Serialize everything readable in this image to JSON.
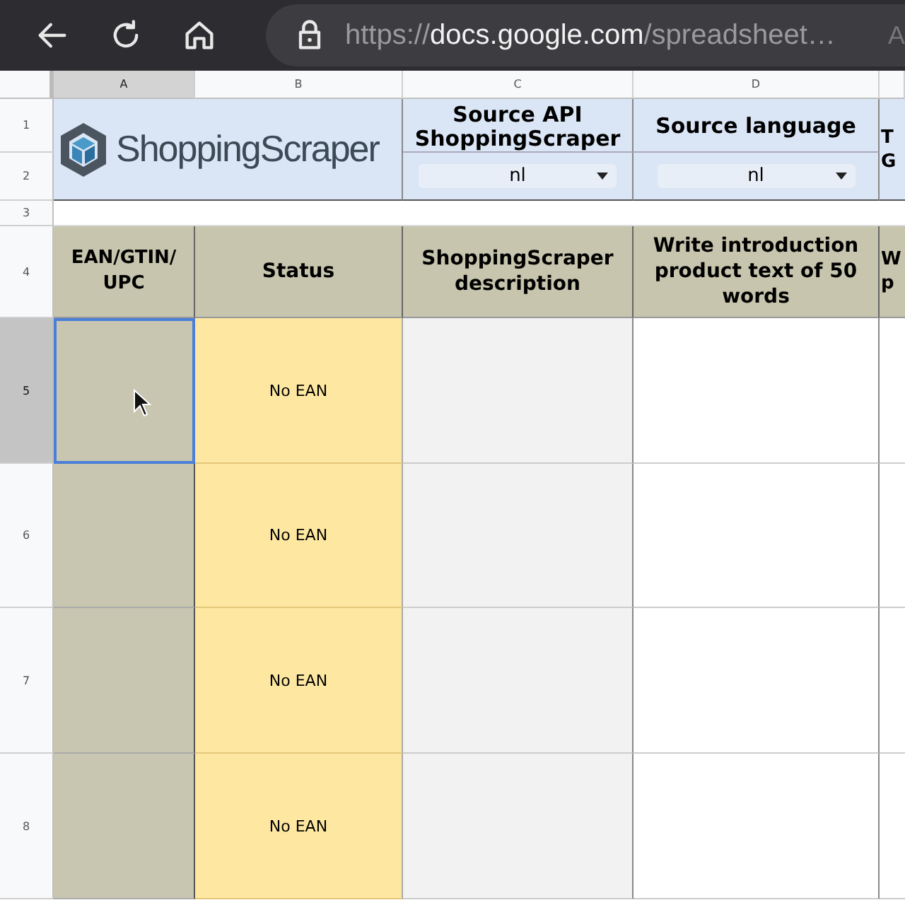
{
  "browser": {
    "url_scheme": "https://",
    "url_host": "docs.google.com",
    "url_path": "/spreadsheet…",
    "edge_text": "A"
  },
  "column_headers": [
    {
      "label": "A",
      "selected": true
    },
    {
      "label": "B",
      "selected": false
    },
    {
      "label": "C",
      "selected": false
    },
    {
      "label": "D",
      "selected": false
    }
  ],
  "row_numbers": [
    {
      "label": "1",
      "selected": false
    },
    {
      "label": "2",
      "selected": false
    },
    {
      "label": "3",
      "selected": false
    },
    {
      "label": "4",
      "selected": false
    },
    {
      "label": "5",
      "selected": true
    },
    {
      "label": "6",
      "selected": false
    },
    {
      "label": "7",
      "selected": false
    },
    {
      "label": "8",
      "selected": false
    }
  ],
  "settings": [
    {
      "label": "Source API ShoppingScraper",
      "value": "nl"
    },
    {
      "label": "Source language",
      "value": "nl"
    }
  ],
  "column_5_top": [
    "T",
    "G"
  ],
  "table": {
    "columns": [
      "EAN/GTIN/UPC",
      "Status",
      "ShoppingScraper description",
      "Write introduction product text of 50 words"
    ],
    "column_5": [
      "W",
      "p"
    ],
    "rows": [
      {
        "status": "No EAN",
        "selected": true
      },
      {
        "status": "No EAN",
        "selected": false
      },
      {
        "status": "No EAN",
        "selected": false
      },
      {
        "status": "No EAN",
        "selected": false
      }
    ]
  },
  "logo": {
    "text": "ShoppingScraper"
  }
}
